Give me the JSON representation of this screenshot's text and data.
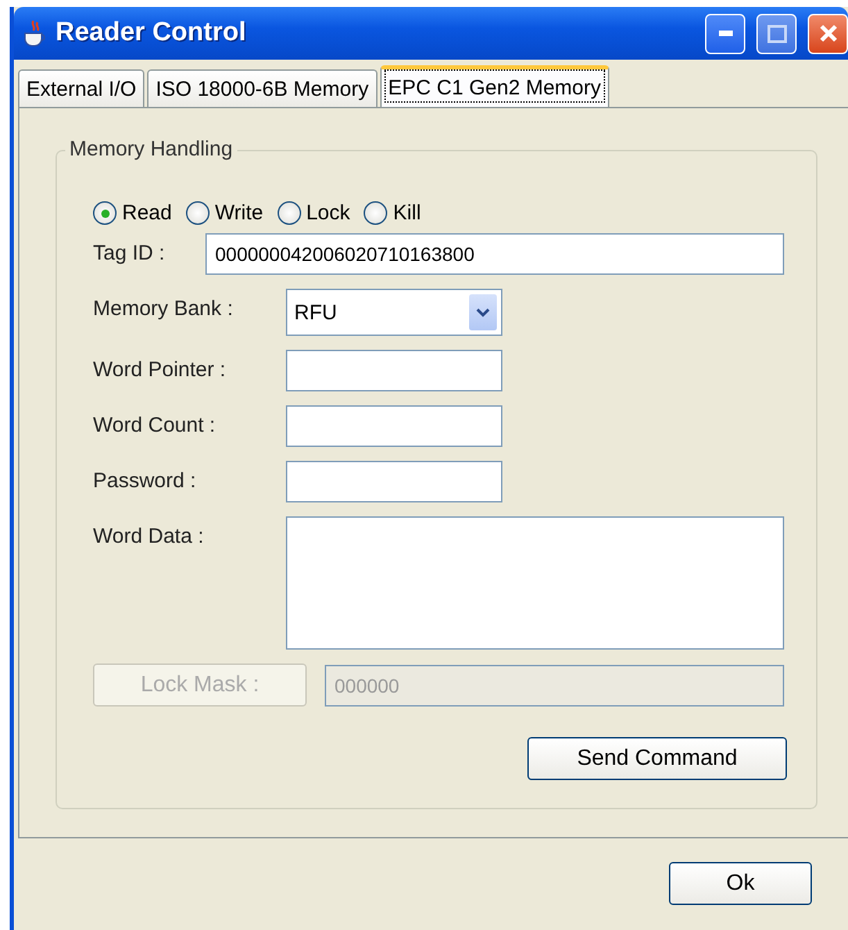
{
  "window": {
    "title": "Reader Control"
  },
  "tabs": [
    {
      "label": "External I/O",
      "selected": false
    },
    {
      "label": "ISO 18000-6B Memory",
      "selected": false
    },
    {
      "label": "EPC C1 Gen2 Memory",
      "selected": true
    }
  ],
  "memory_handling": {
    "title": "Memory Handling",
    "operations": [
      {
        "label": "Read",
        "selected": true
      },
      {
        "label": "Write",
        "selected": false
      },
      {
        "label": "Lock",
        "selected": false
      },
      {
        "label": "Kill",
        "selected": false
      }
    ],
    "fields": [
      {
        "kind": "wide",
        "label": "Tag ID :",
        "value": "000000042006020710163800"
      },
      {
        "kind": "combo",
        "label": "Memory Bank :",
        "value": "RFU"
      },
      {
        "kind": "text",
        "label": "Word Pointer :"
      },
      {
        "kind": "text",
        "label": "Word Count :"
      },
      {
        "kind": "text",
        "label": "Password :"
      },
      {
        "kind": "area",
        "label": "Word Data :"
      }
    ],
    "lock_mask": {
      "label": "Lock Mask :",
      "value": "000000",
      "disabled": true
    },
    "send_button": "Send Command"
  },
  "ok_button": "Ok"
}
